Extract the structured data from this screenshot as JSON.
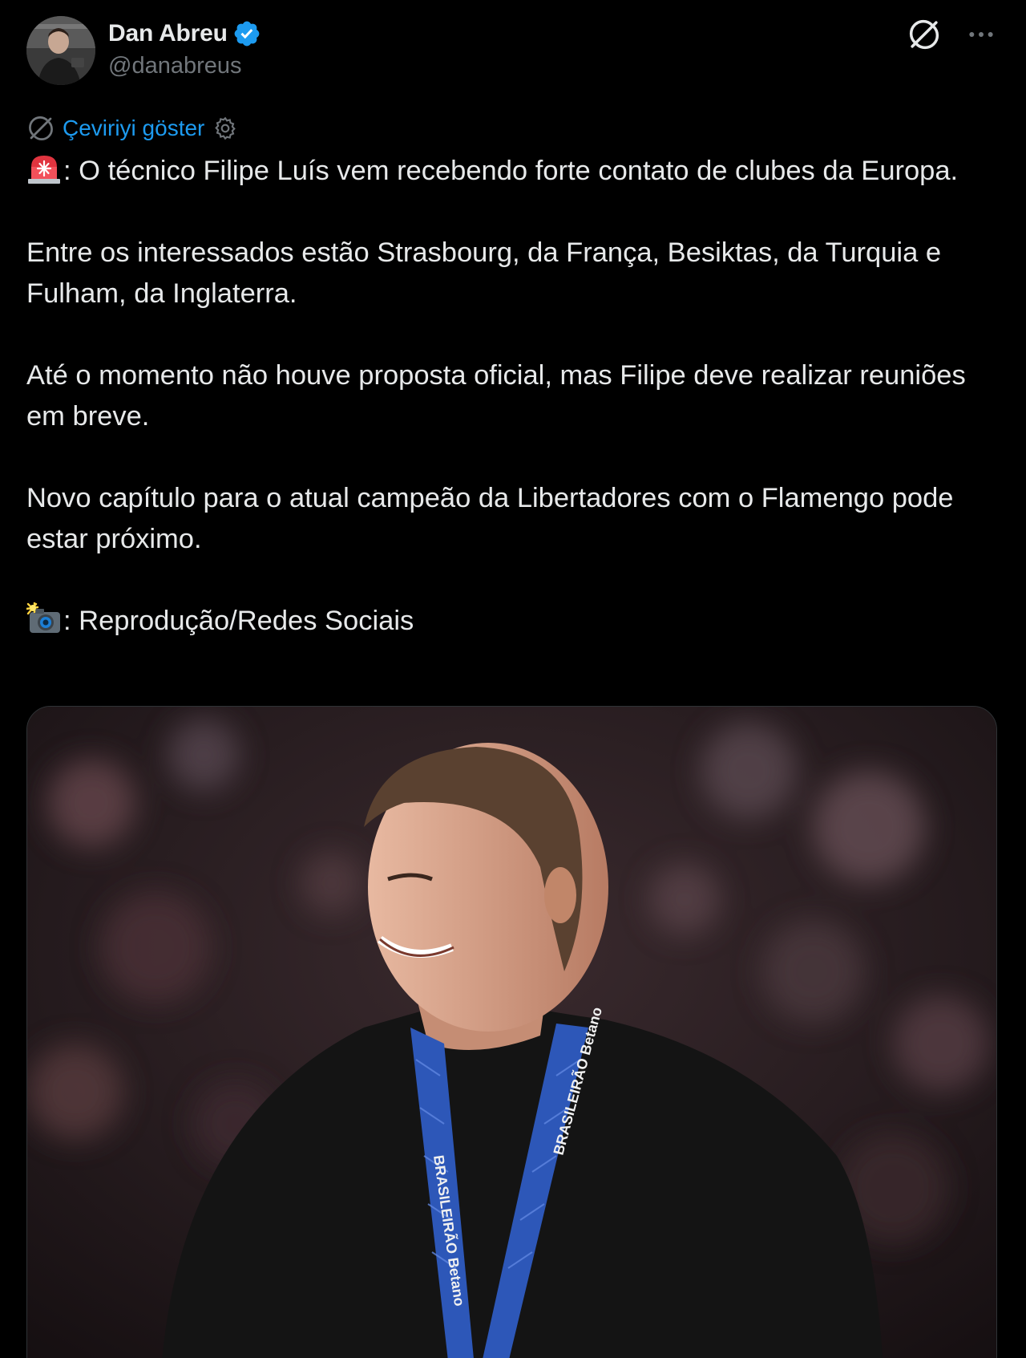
{
  "author": {
    "display_name": "Dan Abreu",
    "handle": "@danabreus",
    "verified": true,
    "avatar_icon": "avatar-photo"
  },
  "actions": {
    "grok_icon": "grok-icon",
    "more_icon": "more-icon"
  },
  "translate": {
    "label": "Çeviriyi göster",
    "icon": "translate-icon",
    "settings_icon": "gear-icon"
  },
  "tweet": {
    "paragraphs": [
      {
        "emoji": "rotating-light-icon",
        "text": ": O técnico Filipe Luís vem recebendo forte contato de clubes da Europa."
      },
      {
        "text": "Entre os interessados estão Strasbourg, da França, Besiktas, da Turquia e Fulham, da Inglaterra."
      },
      {
        "text": "Até o momento não houve proposta oficial, mas Filipe deve realizar reuniões em breve."
      },
      {
        "text": "Novo capítulo para o atual campeão da Libertadores com o Flamengo pode estar próximo."
      },
      {
        "emoji": "camera-flash-icon",
        "text": ": Reprodução/Redes Sociais"
      }
    ]
  },
  "media": {
    "type": "photo",
    "medal_ribbon_text": "BRASILEIRÃO Betano"
  },
  "colors": {
    "background": "#000000",
    "text": "#e7e9ea",
    "secondary": "#71767b",
    "link": "#1d9bf0",
    "verified": "#1d9bf0"
  }
}
